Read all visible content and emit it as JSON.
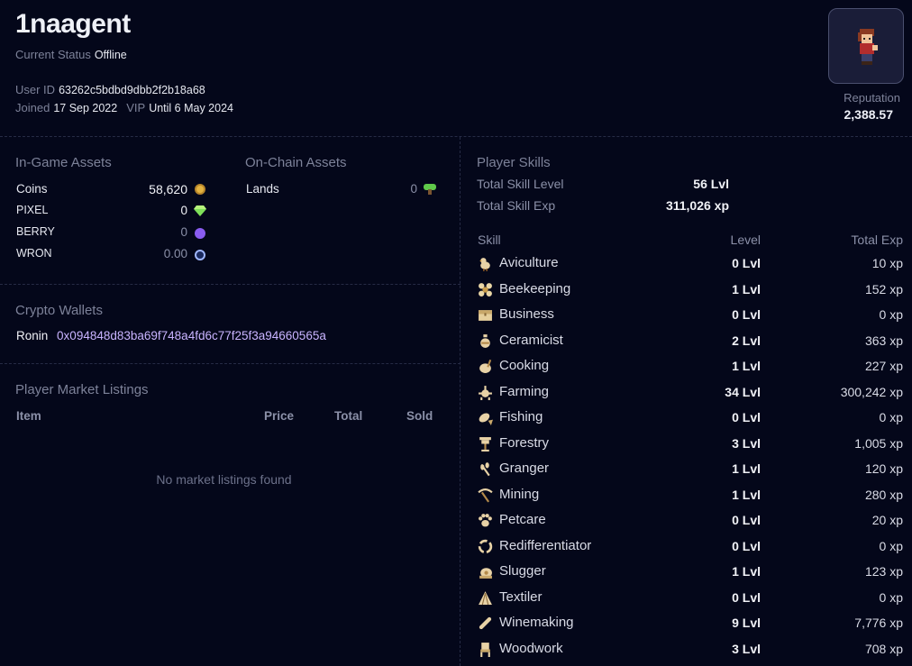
{
  "profile": {
    "username": "1naagent",
    "status_label": "Current Status",
    "status_value": "Offline",
    "user_id_label": "User ID",
    "user_id": "63262c5bdbd9dbb2f2b18a68",
    "joined_label": "Joined",
    "joined": "17 Sep 2022",
    "vip_label": "VIP",
    "vip": "Until 6 May 2024",
    "reputation_label": "Reputation",
    "reputation": "2,388.57"
  },
  "ingame_assets": {
    "title": "In-Game Assets",
    "items": [
      {
        "name": "Coins",
        "value": "58,620",
        "icon": "coin-icon",
        "color": "#e3b341"
      },
      {
        "name": "PIXEL",
        "value": "0",
        "icon": "pixel-gem-icon",
        "color": "#7fe05a"
      },
      {
        "name": "BERRY",
        "value": "0",
        "icon": "berry-icon",
        "color": "#8a5cf0"
      },
      {
        "name": "WRON",
        "value": "0.00",
        "icon": "wron-icon",
        "color": "#9fb6ff"
      }
    ]
  },
  "onchain_assets": {
    "title": "On-Chain Assets",
    "items": [
      {
        "name": "Lands",
        "value": "0",
        "icon": "land-icon",
        "color": "#5fc94a"
      }
    ]
  },
  "wallets": {
    "title": "Crypto Wallets",
    "network": "Ronin",
    "address": "0x094848d83ba69f748a4fd6c77f25f3a94660565a"
  },
  "market": {
    "title": "Player Market Listings",
    "columns": [
      "Item",
      "Price",
      "Total",
      "Sold"
    ],
    "empty_text": "No market listings found"
  },
  "skills": {
    "title": "Player Skills",
    "total_level_label": "Total Skill Level",
    "total_level": "56 Lvl",
    "total_exp_label": "Total Skill Exp",
    "total_exp": "311,026 xp",
    "columns": [
      "Skill",
      "Level",
      "Total Exp"
    ],
    "rows": [
      {
        "name": "Aviculture",
        "level": "0 Lvl",
        "exp": "10 xp",
        "icon": "bird-icon"
      },
      {
        "name": "Beekeeping",
        "level": "1 Lvl",
        "exp": "152 xp",
        "icon": "bee-icon"
      },
      {
        "name": "Business",
        "level": "0 Lvl",
        "exp": "0 xp",
        "icon": "chest-icon"
      },
      {
        "name": "Ceramicist",
        "level": "2 Lvl",
        "exp": "363 xp",
        "icon": "vase-icon"
      },
      {
        "name": "Cooking",
        "level": "1 Lvl",
        "exp": "227 xp",
        "icon": "pot-icon"
      },
      {
        "name": "Farming",
        "level": "34 Lvl",
        "exp": "300,242 xp",
        "icon": "crop-icon"
      },
      {
        "name": "Fishing",
        "level": "0 Lvl",
        "exp": "0 xp",
        "icon": "fish-icon"
      },
      {
        "name": "Forestry",
        "level": "3 Lvl",
        "exp": "1,005 xp",
        "icon": "tree-icon"
      },
      {
        "name": "Granger",
        "level": "1 Lvl",
        "exp": "120 xp",
        "icon": "wheat-icon"
      },
      {
        "name": "Mining",
        "level": "1 Lvl",
        "exp": "280 xp",
        "icon": "pickaxe-icon"
      },
      {
        "name": "Petcare",
        "level": "0 Lvl",
        "exp": "20 xp",
        "icon": "paw-icon"
      },
      {
        "name": "Redifferentiator",
        "level": "0 Lvl",
        "exp": "0 xp",
        "icon": "recycle-icon"
      },
      {
        "name": "Slugger",
        "level": "1 Lvl",
        "exp": "123 xp",
        "icon": "slug-icon"
      },
      {
        "name": "Textiler",
        "level": "0 Lvl",
        "exp": "0 xp",
        "icon": "textile-icon"
      },
      {
        "name": "Winemaking",
        "level": "9 Lvl",
        "exp": "7,776 xp",
        "icon": "bottle-icon"
      },
      {
        "name": "Woodwork",
        "level": "3 Lvl",
        "exp": "708 xp",
        "icon": "chair-icon"
      }
    ]
  }
}
